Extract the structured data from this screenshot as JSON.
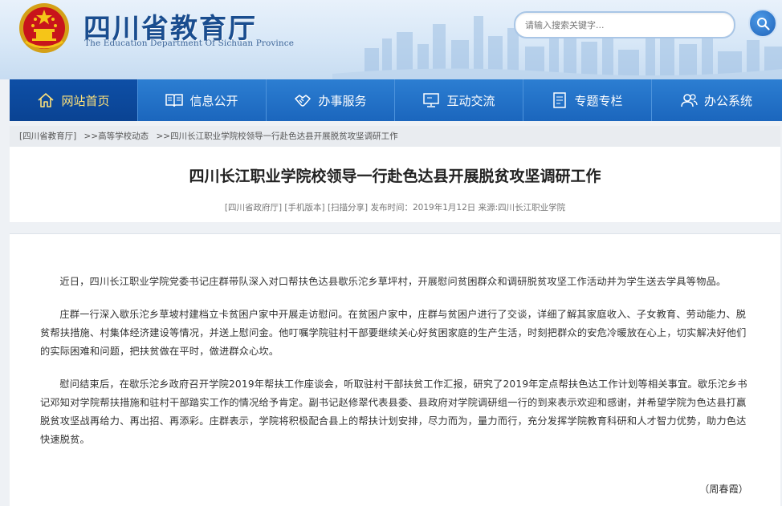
{
  "header": {
    "title": "四川省教育厅",
    "subtitle": "The Education Department Of Sichuan Province",
    "search_placeholder": "请输入搜索关键字..."
  },
  "nav": {
    "items": [
      {
        "label": "网站首页",
        "icon": "home-icon"
      },
      {
        "label": "信息公开",
        "icon": "book-icon"
      },
      {
        "label": "办事服务",
        "icon": "handshake-icon"
      },
      {
        "label": "互动交流",
        "icon": "monitor-icon"
      },
      {
        "label": "专题专栏",
        "icon": "document-icon"
      },
      {
        "label": "办公系统",
        "icon": "users-icon"
      }
    ]
  },
  "breadcrumb": {
    "items": [
      "[四川省教育厅]",
      ">>高等学校动态",
      ">>四川长江职业学院校领导一行赴色达县开展脱贫攻坚调研工作"
    ]
  },
  "article": {
    "title": "四川长江职业学院校领导一行赴色达县开展脱贫攻坚调研工作",
    "meta_site": "[四川省政府厅]",
    "meta_mobile": "[手机版本]",
    "meta_share": "[扫描分享]",
    "meta_info": "发布时间：2019年1月12日 来源:四川长江职业学院",
    "paragraphs": [
      "近日，四川长江职业学院党委书记庄群带队深入对口帮扶色达县歇乐沱乡草坪村，开展慰问贫困群众和调研脱贫攻坚工作活动并为学生送去学具等物品。",
      "庄群一行深入歇乐沱乡草坡村建档立卡贫困户家中开展走访慰问。在贫困户家中，庄群与贫困户进行了交谈，详细了解其家庭收入、子女教育、劳动能力、脱贫帮扶措施、村集体经济建设等情况，并送上慰问金。他叮嘱学院驻村干部要继续关心好贫困家庭的生产生活，时刻把群众的安危冷暖放在心上，切实解决好他们的实际困难和问题，把扶贫做在平时，做进群众心坎。",
      "慰问结束后，在歇乐沱乡政府召开学院2019年帮扶工作座谈会，听取驻村干部扶贫工作汇报，研究了2019年定点帮扶色达工作计划等相关事宜。歇乐沱乡书记邓知对学院帮扶措施和驻村干部踏实工作的情况给予肯定。副书记赵修翠代表县委、县政府对学院调研组一行的到来表示欢迎和感谢，并希望学院为色达县打赢脱贫攻坚战再给力、再出招、再添彩。庄群表示，学院将积极配合县上的帮扶计划安排，尽力而为，量力而行，充分发挥学院教育科研和人才智力优势，助力色达快速脱贫。"
    ],
    "author": "（周春霞）"
  }
}
